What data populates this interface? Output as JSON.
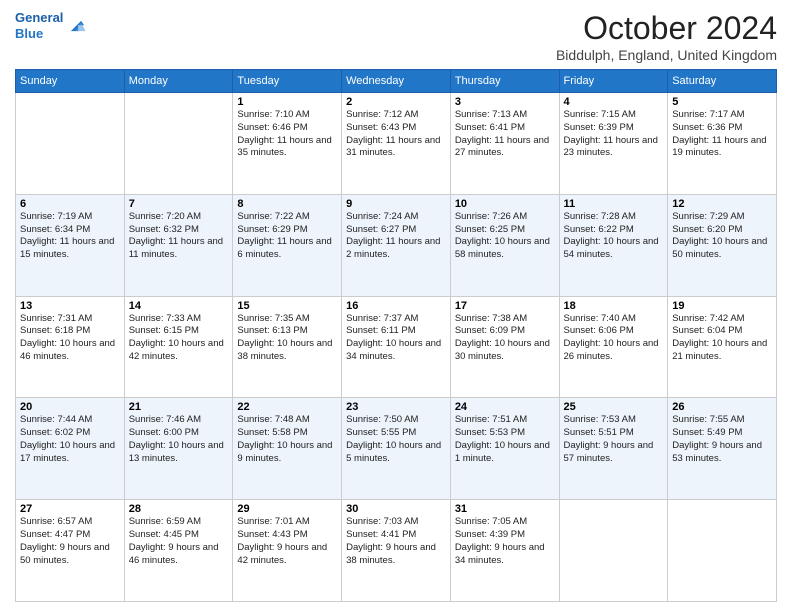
{
  "header": {
    "logo_line1": "General",
    "logo_line2": "Blue",
    "month": "October 2024",
    "location": "Biddulph, England, United Kingdom"
  },
  "days_of_week": [
    "Sunday",
    "Monday",
    "Tuesday",
    "Wednesday",
    "Thursday",
    "Friday",
    "Saturday"
  ],
  "weeks": [
    [
      null,
      null,
      {
        "day": "1",
        "sunrise": "Sunrise: 7:10 AM",
        "sunset": "Sunset: 6:46 PM",
        "daylight": "Daylight: 11 hours and 35 minutes."
      },
      {
        "day": "2",
        "sunrise": "Sunrise: 7:12 AM",
        "sunset": "Sunset: 6:43 PM",
        "daylight": "Daylight: 11 hours and 31 minutes."
      },
      {
        "day": "3",
        "sunrise": "Sunrise: 7:13 AM",
        "sunset": "Sunset: 6:41 PM",
        "daylight": "Daylight: 11 hours and 27 minutes."
      },
      {
        "day": "4",
        "sunrise": "Sunrise: 7:15 AM",
        "sunset": "Sunset: 6:39 PM",
        "daylight": "Daylight: 11 hours and 23 minutes."
      },
      {
        "day": "5",
        "sunrise": "Sunrise: 7:17 AM",
        "sunset": "Sunset: 6:36 PM",
        "daylight": "Daylight: 11 hours and 19 minutes."
      }
    ],
    [
      {
        "day": "6",
        "sunrise": "Sunrise: 7:19 AM",
        "sunset": "Sunset: 6:34 PM",
        "daylight": "Daylight: 11 hours and 15 minutes."
      },
      {
        "day": "7",
        "sunrise": "Sunrise: 7:20 AM",
        "sunset": "Sunset: 6:32 PM",
        "daylight": "Daylight: 11 hours and 11 minutes."
      },
      {
        "day": "8",
        "sunrise": "Sunrise: 7:22 AM",
        "sunset": "Sunset: 6:29 PM",
        "daylight": "Daylight: 11 hours and 6 minutes."
      },
      {
        "day": "9",
        "sunrise": "Sunrise: 7:24 AM",
        "sunset": "Sunset: 6:27 PM",
        "daylight": "Daylight: 11 hours and 2 minutes."
      },
      {
        "day": "10",
        "sunrise": "Sunrise: 7:26 AM",
        "sunset": "Sunset: 6:25 PM",
        "daylight": "Daylight: 10 hours and 58 minutes."
      },
      {
        "day": "11",
        "sunrise": "Sunrise: 7:28 AM",
        "sunset": "Sunset: 6:22 PM",
        "daylight": "Daylight: 10 hours and 54 minutes."
      },
      {
        "day": "12",
        "sunrise": "Sunrise: 7:29 AM",
        "sunset": "Sunset: 6:20 PM",
        "daylight": "Daylight: 10 hours and 50 minutes."
      }
    ],
    [
      {
        "day": "13",
        "sunrise": "Sunrise: 7:31 AM",
        "sunset": "Sunset: 6:18 PM",
        "daylight": "Daylight: 10 hours and 46 minutes."
      },
      {
        "day": "14",
        "sunrise": "Sunrise: 7:33 AM",
        "sunset": "Sunset: 6:15 PM",
        "daylight": "Daylight: 10 hours and 42 minutes."
      },
      {
        "day": "15",
        "sunrise": "Sunrise: 7:35 AM",
        "sunset": "Sunset: 6:13 PM",
        "daylight": "Daylight: 10 hours and 38 minutes."
      },
      {
        "day": "16",
        "sunrise": "Sunrise: 7:37 AM",
        "sunset": "Sunset: 6:11 PM",
        "daylight": "Daylight: 10 hours and 34 minutes."
      },
      {
        "day": "17",
        "sunrise": "Sunrise: 7:38 AM",
        "sunset": "Sunset: 6:09 PM",
        "daylight": "Daylight: 10 hours and 30 minutes."
      },
      {
        "day": "18",
        "sunrise": "Sunrise: 7:40 AM",
        "sunset": "Sunset: 6:06 PM",
        "daylight": "Daylight: 10 hours and 26 minutes."
      },
      {
        "day": "19",
        "sunrise": "Sunrise: 7:42 AM",
        "sunset": "Sunset: 6:04 PM",
        "daylight": "Daylight: 10 hours and 21 minutes."
      }
    ],
    [
      {
        "day": "20",
        "sunrise": "Sunrise: 7:44 AM",
        "sunset": "Sunset: 6:02 PM",
        "daylight": "Daylight: 10 hours and 17 minutes."
      },
      {
        "day": "21",
        "sunrise": "Sunrise: 7:46 AM",
        "sunset": "Sunset: 6:00 PM",
        "daylight": "Daylight: 10 hours and 13 minutes."
      },
      {
        "day": "22",
        "sunrise": "Sunrise: 7:48 AM",
        "sunset": "Sunset: 5:58 PM",
        "daylight": "Daylight: 10 hours and 9 minutes."
      },
      {
        "day": "23",
        "sunrise": "Sunrise: 7:50 AM",
        "sunset": "Sunset: 5:55 PM",
        "daylight": "Daylight: 10 hours and 5 minutes."
      },
      {
        "day": "24",
        "sunrise": "Sunrise: 7:51 AM",
        "sunset": "Sunset: 5:53 PM",
        "daylight": "Daylight: 10 hours and 1 minute."
      },
      {
        "day": "25",
        "sunrise": "Sunrise: 7:53 AM",
        "sunset": "Sunset: 5:51 PM",
        "daylight": "Daylight: 9 hours and 57 minutes."
      },
      {
        "day": "26",
        "sunrise": "Sunrise: 7:55 AM",
        "sunset": "Sunset: 5:49 PM",
        "daylight": "Daylight: 9 hours and 53 minutes."
      }
    ],
    [
      {
        "day": "27",
        "sunrise": "Sunrise: 6:57 AM",
        "sunset": "Sunset: 4:47 PM",
        "daylight": "Daylight: 9 hours and 50 minutes."
      },
      {
        "day": "28",
        "sunrise": "Sunrise: 6:59 AM",
        "sunset": "Sunset: 4:45 PM",
        "daylight": "Daylight: 9 hours and 46 minutes."
      },
      {
        "day": "29",
        "sunrise": "Sunrise: 7:01 AM",
        "sunset": "Sunset: 4:43 PM",
        "daylight": "Daylight: 9 hours and 42 minutes."
      },
      {
        "day": "30",
        "sunrise": "Sunrise: 7:03 AM",
        "sunset": "Sunset: 4:41 PM",
        "daylight": "Daylight: 9 hours and 38 minutes."
      },
      {
        "day": "31",
        "sunrise": "Sunrise: 7:05 AM",
        "sunset": "Sunset: 4:39 PM",
        "daylight": "Daylight: 9 hours and 34 minutes."
      },
      null,
      null
    ]
  ]
}
